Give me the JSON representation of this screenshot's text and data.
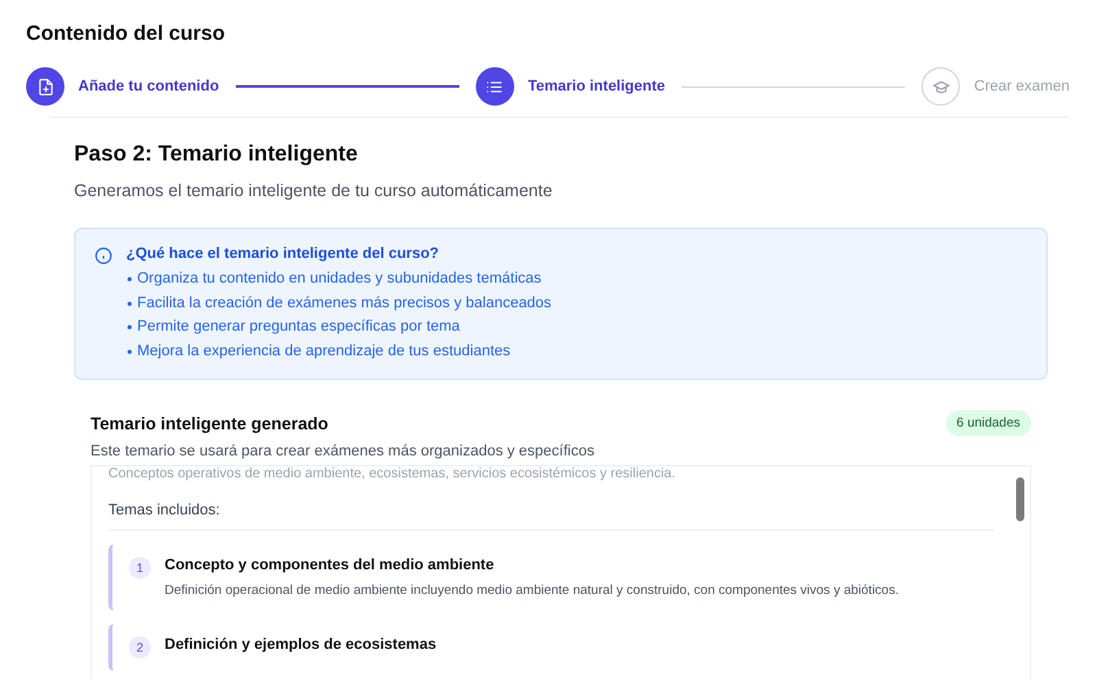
{
  "page_title": "Contenido del curso",
  "steps": [
    {
      "label": "Añade tu contenido",
      "kind": "done"
    },
    {
      "label": "Temario inteligente",
      "kind": "current"
    },
    {
      "label": "Crear examen",
      "kind": "pending"
    }
  ],
  "step_heading": "Paso 2: Temario inteligente",
  "step_subtitle": "Generamos el temario inteligente de tu curso automáticamente",
  "info": {
    "title": "¿Qué hace el temario inteligente del curso?",
    "bullets": [
      "Organiza tu contenido en unidades y subunidades temáticas",
      "Facilita la creación de exámenes más precisos y balanceados",
      "Permite generar preguntas específicas por tema",
      "Mejora la experiencia de aprendizaje de tus estudiantes"
    ]
  },
  "syllabus": {
    "title": "Temario inteligente generado",
    "badge": "6 unidades",
    "subtitle": "Este temario se usará para crear exámenes más organizados y específicos",
    "summary": "Conceptos operativos de medio ambiente, ecosistemas, servicios ecosistémicos y resiliencia.",
    "topics_label": "Temas incluidos:",
    "topics": [
      {
        "number": "1",
        "title": "Concepto y componentes del medio ambiente",
        "description": "Definición operacional de medio ambiente incluyendo medio ambiente natural y construido, con componentes vivos y abióticos."
      },
      {
        "number": "2",
        "title": "Definición y ejemplos de ecosistemas"
      }
    ]
  }
}
